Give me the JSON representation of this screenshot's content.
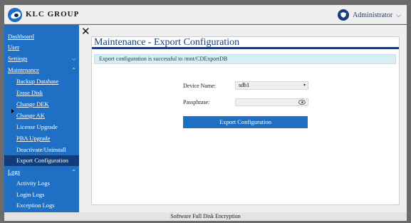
{
  "header": {
    "brand": "KLC GROUP",
    "user_name": "Administrator",
    "user_caret": "⌵"
  },
  "sidebar": {
    "items": [
      {
        "label": "Dashboard",
        "underline": "D"
      },
      {
        "label": "User"
      },
      {
        "label": "Settings",
        "chevron": "⌵"
      },
      {
        "label": "Maintenance",
        "chevron": "⌃"
      },
      {
        "label": "Backup Database"
      },
      {
        "label": "Erase Disk"
      },
      {
        "label": "Change DEK"
      },
      {
        "label": "Change AK"
      },
      {
        "label": "License Upgrade"
      },
      {
        "label": "PBA Upgrade"
      },
      {
        "label": "Deactivate/Uninstall PBA"
      },
      {
        "label": "Export Configuration",
        "active": true
      },
      {
        "label": "Logs",
        "chevron": "⌃"
      },
      {
        "label": "Activity Logs"
      },
      {
        "label": "Login Logs"
      },
      {
        "label": "Exception Logs"
      }
    ]
  },
  "close_glyph": "✕",
  "panel": {
    "title": "Maintenance - Export Configuration",
    "alert": "Export configuration is successful to /mnt/CDExportDB",
    "device_label": "Device Name:",
    "device_value": "sdb1",
    "device_arrow": "▾",
    "passphrase_label": "Passphrase:",
    "passphrase_value": "",
    "button_label": "Export Configuration"
  },
  "footer": {
    "text": "Software Full Disk Encryption"
  },
  "colors": {
    "sidebar_bg": "#1f6fc5",
    "sidebar_active": "#0f3c7a",
    "title_color": "#1b3d7a",
    "alert_bg": "#d9eef4",
    "button_bg": "#1f6fc5"
  }
}
